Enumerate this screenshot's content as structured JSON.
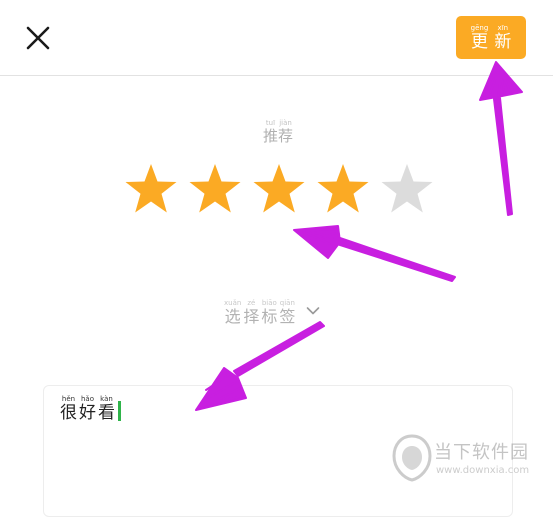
{
  "header": {
    "close_icon": "close-icon",
    "update_button": {
      "chars": [
        {
          "pinyin": "gēng",
          "char": "更"
        },
        {
          "pinyin": "xīn",
          "char": "新"
        }
      ],
      "color": "#fbaa24"
    }
  },
  "rating": {
    "label": [
      {
        "pinyin": "tuī",
        "char": "推"
      },
      {
        "pinyin": "jiàn",
        "char": "荐"
      }
    ],
    "value": 4,
    "max": 5,
    "filled_color": "#fbaa24",
    "empty_color": "#dcdcdc"
  },
  "tags": {
    "label": [
      {
        "pinyin": "xuǎn",
        "char": "选"
      },
      {
        "pinyin": "zé",
        "char": "择"
      },
      {
        "pinyin": "biāo",
        "char": "标"
      },
      {
        "pinyin": "qiān",
        "char": "签"
      }
    ],
    "dropdown_icon": "chevron-down-icon"
  },
  "review": {
    "chars": [
      {
        "pinyin": "hěn",
        "char": "很"
      },
      {
        "pinyin": "hǎo",
        "char": "好"
      },
      {
        "pinyin": "kàn",
        "char": "看"
      }
    ],
    "caret_color": "#2fb44a"
  },
  "watermark": {
    "brand": "当下软件园",
    "url": "www.downxia.com"
  },
  "annotation_color": "#c81fe0"
}
